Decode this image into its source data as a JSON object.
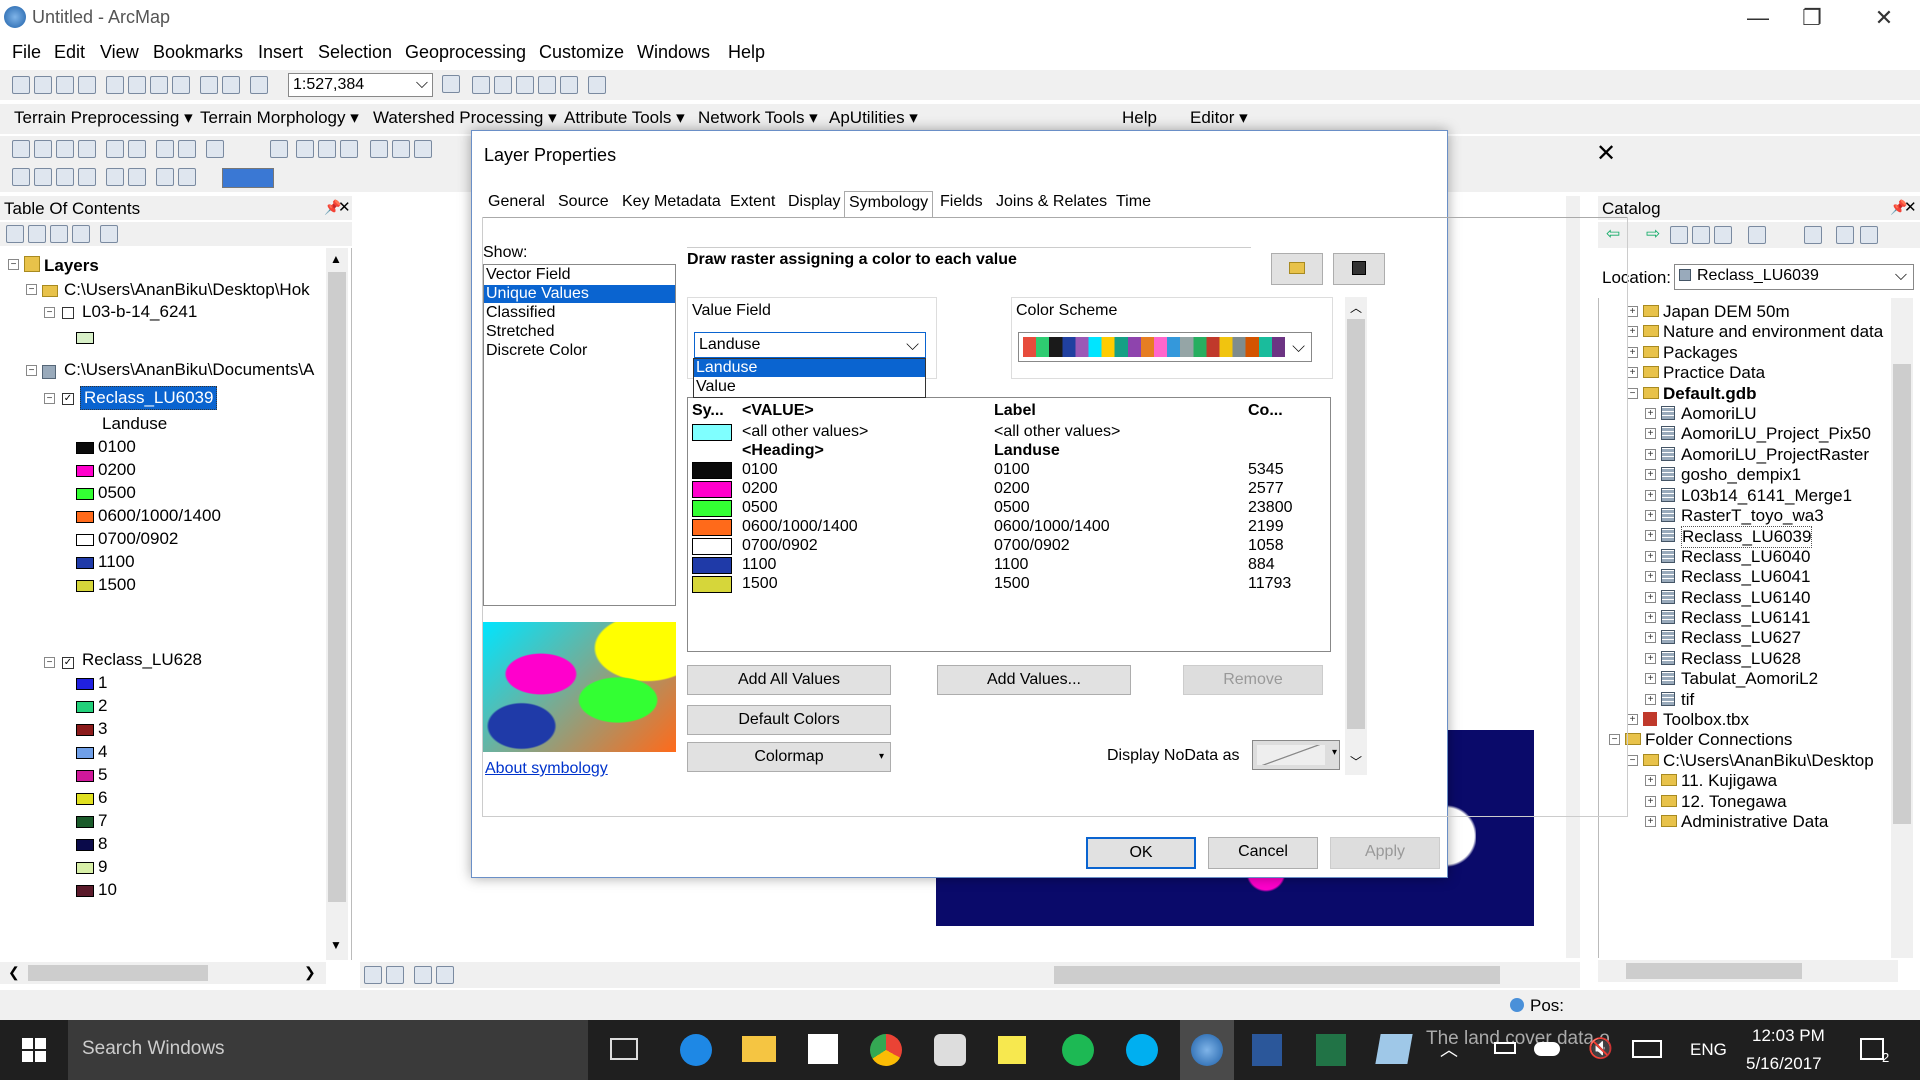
{
  "window": {
    "title": "Untitled - ArcMap",
    "minimize": "—",
    "restore": "❐",
    "close": "✕"
  },
  "menu": [
    "File",
    "Edit",
    "View",
    "Bookmarks",
    "Insert",
    "Selection",
    "Geoprocessing",
    "Customize",
    "Windows",
    "Help"
  ],
  "toolbar": {
    "scale": "1:527,384"
  },
  "toolbar2": [
    "Terrain Preprocessing ▾",
    "Terrain Morphology ▾",
    "Watershed Processing ▾",
    "Attribute Tools ▾",
    "Network Tools ▾",
    "ApUtilities ▾",
    "Help",
    "Editor ▾"
  ],
  "toc": {
    "title": "Table Of Contents",
    "layers_label": "Layers",
    "group1": "C:\\Users\\AnanBiku\\Desktop\\Hok",
    "layer1": "L03-b-14_6241",
    "group2": "C:\\Users\\AnanBiku\\Documents\\A",
    "layer_selected": "Reclass_LU6039",
    "landuse_heading": "Landuse",
    "classes1": [
      {
        "label": "0100",
        "color": "#0a0a0a"
      },
      {
        "label": "0200",
        "color": "#ff00cc"
      },
      {
        "label": "0500",
        "color": "#33ff33"
      },
      {
        "label": "0600/1000/1400",
        "color": "#ff6a1a"
      },
      {
        "label": "0700/0902",
        "color": "#ffffff"
      },
      {
        "label": "1100",
        "color": "#1f3aa8"
      },
      {
        "label": "1500",
        "color": "#d6d63a"
      }
    ],
    "layer2": "Reclass_LU628",
    "classes2": [
      {
        "label": "1",
        "color": "#2020e0"
      },
      {
        "label": "2",
        "color": "#22d07a"
      },
      {
        "label": "3",
        "color": "#8b1a1a"
      },
      {
        "label": "4",
        "color": "#6f9fe8"
      },
      {
        "label": "5",
        "color": "#d0189a"
      },
      {
        "label": "6",
        "color": "#e0e020"
      },
      {
        "label": "7",
        "color": "#1a5a2a"
      },
      {
        "label": "8",
        "color": "#0a0a4a"
      },
      {
        "label": "9",
        "color": "#d8f0a8"
      },
      {
        "label": "10",
        "color": "#5a1a2a"
      }
    ]
  },
  "dialog": {
    "title": "Layer Properties",
    "tabs": [
      "General",
      "Source",
      "Key Metadata",
      "Extent",
      "Display",
      "Symbology",
      "Fields",
      "Joins & Relates",
      "Time"
    ],
    "show_label": "Show:",
    "show_items": [
      "Vector Field",
      "Unique Values",
      "Classified",
      "Stretched",
      "Discrete Color"
    ],
    "description": "Draw raster assigning a color to each value",
    "value_field_label": "Value Field",
    "value_field_selected": "Landuse",
    "dropdown_options": [
      "Landuse",
      "Value"
    ],
    "color_scheme_label": "Color Scheme",
    "columns": [
      "Sy...",
      "<VALUE>",
      "Label",
      "Co..."
    ],
    "rows": [
      {
        "value": "<all other values>",
        "label": "<all other values>",
        "count": "",
        "color": "#7fffff"
      },
      {
        "value": "<Heading>",
        "label": "Landuse",
        "count": "",
        "color": ""
      },
      {
        "value": "0100",
        "label": "0100",
        "count": "5345",
        "color": "#0a0a0a"
      },
      {
        "value": "0200",
        "label": "0200",
        "count": "2577",
        "color": "#ff00cc"
      },
      {
        "value": "0500",
        "label": "0500",
        "count": "23800",
        "color": "#33ff33"
      },
      {
        "value": "0600/1000/1400",
        "label": "0600/1000/1400",
        "count": "2199",
        "color": "#ff6a1a"
      },
      {
        "value": "0700/0902",
        "label": "0700/0902",
        "count": "1058",
        "color": "#ffffff"
      },
      {
        "value": "1100",
        "label": "1100",
        "count": "884",
        "color": "#1f3aa8"
      },
      {
        "value": "1500",
        "label": "1500",
        "count": "11793",
        "color": "#d6d63a"
      }
    ],
    "add_all_values": "Add All Values",
    "add_values": "Add Values...",
    "remove": "Remove",
    "default_colors": "Default Colors",
    "colormap": "Colormap",
    "display_nodata": "Display NoData as",
    "about": "About symbology",
    "ok": "OK",
    "cancel": "Cancel",
    "apply": "Apply"
  },
  "catalog": {
    "title": "Catalog",
    "location_label": "Location:",
    "location_value": "Reclass_LU6039",
    "items": [
      {
        "label": "Japan DEM 50m",
        "type": "folder"
      },
      {
        "label": "Nature and environment data",
        "type": "folder"
      },
      {
        "label": "Packages",
        "type": "folder"
      },
      {
        "label": "Practice Data",
        "type": "folder"
      },
      {
        "label": "Default.gdb",
        "type": "gdb"
      },
      {
        "label": "AomoriLU",
        "type": "raster"
      },
      {
        "label": "AomoriLU_Project_Pix50",
        "type": "raster"
      },
      {
        "label": "AomoriLU_ProjectRaster",
        "type": "raster"
      },
      {
        "label": "gosho_dempix1",
        "type": "raster"
      },
      {
        "label": "L03b14_6141_Merge1",
        "type": "raster"
      },
      {
        "label": "RasterT_toyo_wa3",
        "type": "raster"
      },
      {
        "label": "Reclass_LU6039",
        "type": "raster"
      },
      {
        "label": "Reclass_LU6040",
        "type": "raster"
      },
      {
        "label": "Reclass_LU6041",
        "type": "raster"
      },
      {
        "label": "Reclass_LU6140",
        "type": "raster"
      },
      {
        "label": "Reclass_LU6141",
        "type": "raster"
      },
      {
        "label": "Reclass_LU627",
        "type": "raster"
      },
      {
        "label": "Reclass_LU628",
        "type": "raster"
      },
      {
        "label": "Tabulat_AomoriL2",
        "type": "table"
      },
      {
        "label": "tif",
        "type": "raster"
      },
      {
        "label": "Toolbox.tbx",
        "type": "toolbox"
      },
      {
        "label": "Folder Connections",
        "type": "folder"
      },
      {
        "label": "C:\\Users\\AnanBiku\\Desktop",
        "type": "folder"
      },
      {
        "label": "11. Kujigawa",
        "type": "folder"
      },
      {
        "label": "12. Tonegawa",
        "type": "folder"
      },
      {
        "label": "Administrative Data",
        "type": "folder"
      }
    ]
  },
  "status": {
    "pos": "Pos:"
  },
  "taskbar": {
    "search": "Search Windows",
    "overlay_text": "The land cover data o",
    "lang": "ENG",
    "time": "12:03 PM",
    "date": "5/16/2017",
    "notif": "2"
  }
}
